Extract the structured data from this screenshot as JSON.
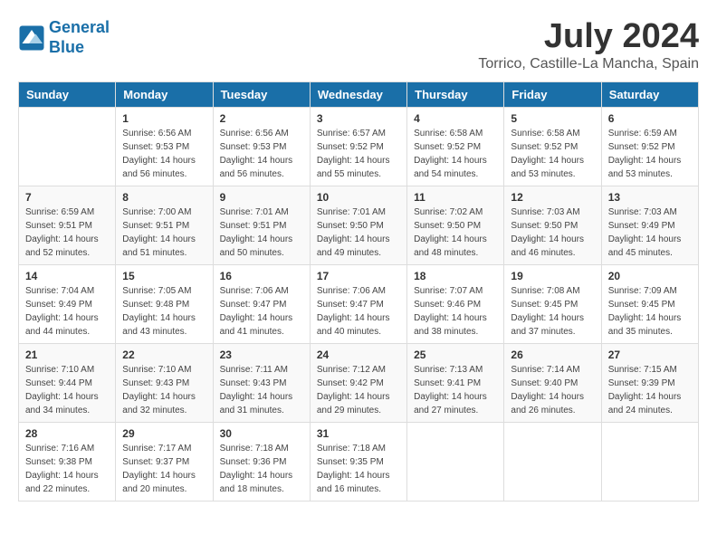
{
  "app": {
    "name_line1": "General",
    "name_line2": "Blue"
  },
  "header": {
    "title": "July 2024",
    "subtitle": "Torrico, Castille-La Mancha, Spain"
  },
  "columns": [
    "Sunday",
    "Monday",
    "Tuesday",
    "Wednesday",
    "Thursday",
    "Friday",
    "Saturday"
  ],
  "weeks": [
    [
      {
        "day": "",
        "sunrise": "",
        "sunset": "",
        "daylight": ""
      },
      {
        "day": "1",
        "sunrise": "Sunrise: 6:56 AM",
        "sunset": "Sunset: 9:53 PM",
        "daylight": "Daylight: 14 hours and 56 minutes."
      },
      {
        "day": "2",
        "sunrise": "Sunrise: 6:56 AM",
        "sunset": "Sunset: 9:53 PM",
        "daylight": "Daylight: 14 hours and 56 minutes."
      },
      {
        "day": "3",
        "sunrise": "Sunrise: 6:57 AM",
        "sunset": "Sunset: 9:52 PM",
        "daylight": "Daylight: 14 hours and 55 minutes."
      },
      {
        "day": "4",
        "sunrise": "Sunrise: 6:58 AM",
        "sunset": "Sunset: 9:52 PM",
        "daylight": "Daylight: 14 hours and 54 minutes."
      },
      {
        "day": "5",
        "sunrise": "Sunrise: 6:58 AM",
        "sunset": "Sunset: 9:52 PM",
        "daylight": "Daylight: 14 hours and 53 minutes."
      },
      {
        "day": "6",
        "sunrise": "Sunrise: 6:59 AM",
        "sunset": "Sunset: 9:52 PM",
        "daylight": "Daylight: 14 hours and 53 minutes."
      }
    ],
    [
      {
        "day": "7",
        "sunrise": "Sunrise: 6:59 AM",
        "sunset": "Sunset: 9:51 PM",
        "daylight": "Daylight: 14 hours and 52 minutes."
      },
      {
        "day": "8",
        "sunrise": "Sunrise: 7:00 AM",
        "sunset": "Sunset: 9:51 PM",
        "daylight": "Daylight: 14 hours and 51 minutes."
      },
      {
        "day": "9",
        "sunrise": "Sunrise: 7:01 AM",
        "sunset": "Sunset: 9:51 PM",
        "daylight": "Daylight: 14 hours and 50 minutes."
      },
      {
        "day": "10",
        "sunrise": "Sunrise: 7:01 AM",
        "sunset": "Sunset: 9:50 PM",
        "daylight": "Daylight: 14 hours and 49 minutes."
      },
      {
        "day": "11",
        "sunrise": "Sunrise: 7:02 AM",
        "sunset": "Sunset: 9:50 PM",
        "daylight": "Daylight: 14 hours and 48 minutes."
      },
      {
        "day": "12",
        "sunrise": "Sunrise: 7:03 AM",
        "sunset": "Sunset: 9:50 PM",
        "daylight": "Daylight: 14 hours and 46 minutes."
      },
      {
        "day": "13",
        "sunrise": "Sunrise: 7:03 AM",
        "sunset": "Sunset: 9:49 PM",
        "daylight": "Daylight: 14 hours and 45 minutes."
      }
    ],
    [
      {
        "day": "14",
        "sunrise": "Sunrise: 7:04 AM",
        "sunset": "Sunset: 9:49 PM",
        "daylight": "Daylight: 14 hours and 44 minutes."
      },
      {
        "day": "15",
        "sunrise": "Sunrise: 7:05 AM",
        "sunset": "Sunset: 9:48 PM",
        "daylight": "Daylight: 14 hours and 43 minutes."
      },
      {
        "day": "16",
        "sunrise": "Sunrise: 7:06 AM",
        "sunset": "Sunset: 9:47 PM",
        "daylight": "Daylight: 14 hours and 41 minutes."
      },
      {
        "day": "17",
        "sunrise": "Sunrise: 7:06 AM",
        "sunset": "Sunset: 9:47 PM",
        "daylight": "Daylight: 14 hours and 40 minutes."
      },
      {
        "day": "18",
        "sunrise": "Sunrise: 7:07 AM",
        "sunset": "Sunset: 9:46 PM",
        "daylight": "Daylight: 14 hours and 38 minutes."
      },
      {
        "day": "19",
        "sunrise": "Sunrise: 7:08 AM",
        "sunset": "Sunset: 9:45 PM",
        "daylight": "Daylight: 14 hours and 37 minutes."
      },
      {
        "day": "20",
        "sunrise": "Sunrise: 7:09 AM",
        "sunset": "Sunset: 9:45 PM",
        "daylight": "Daylight: 14 hours and 35 minutes."
      }
    ],
    [
      {
        "day": "21",
        "sunrise": "Sunrise: 7:10 AM",
        "sunset": "Sunset: 9:44 PM",
        "daylight": "Daylight: 14 hours and 34 minutes."
      },
      {
        "day": "22",
        "sunrise": "Sunrise: 7:10 AM",
        "sunset": "Sunset: 9:43 PM",
        "daylight": "Daylight: 14 hours and 32 minutes."
      },
      {
        "day": "23",
        "sunrise": "Sunrise: 7:11 AM",
        "sunset": "Sunset: 9:43 PM",
        "daylight": "Daylight: 14 hours and 31 minutes."
      },
      {
        "day": "24",
        "sunrise": "Sunrise: 7:12 AM",
        "sunset": "Sunset: 9:42 PM",
        "daylight": "Daylight: 14 hours and 29 minutes."
      },
      {
        "day": "25",
        "sunrise": "Sunrise: 7:13 AM",
        "sunset": "Sunset: 9:41 PM",
        "daylight": "Daylight: 14 hours and 27 minutes."
      },
      {
        "day": "26",
        "sunrise": "Sunrise: 7:14 AM",
        "sunset": "Sunset: 9:40 PM",
        "daylight": "Daylight: 14 hours and 26 minutes."
      },
      {
        "day": "27",
        "sunrise": "Sunrise: 7:15 AM",
        "sunset": "Sunset: 9:39 PM",
        "daylight": "Daylight: 14 hours and 24 minutes."
      }
    ],
    [
      {
        "day": "28",
        "sunrise": "Sunrise: 7:16 AM",
        "sunset": "Sunset: 9:38 PM",
        "daylight": "Daylight: 14 hours and 22 minutes."
      },
      {
        "day": "29",
        "sunrise": "Sunrise: 7:17 AM",
        "sunset": "Sunset: 9:37 PM",
        "daylight": "Daylight: 14 hours and 20 minutes."
      },
      {
        "day": "30",
        "sunrise": "Sunrise: 7:18 AM",
        "sunset": "Sunset: 9:36 PM",
        "daylight": "Daylight: 14 hours and 18 minutes."
      },
      {
        "day": "31",
        "sunrise": "Sunrise: 7:18 AM",
        "sunset": "Sunset: 9:35 PM",
        "daylight": "Daylight: 14 hours and 16 minutes."
      },
      {
        "day": "",
        "sunrise": "",
        "sunset": "",
        "daylight": ""
      },
      {
        "day": "",
        "sunrise": "",
        "sunset": "",
        "daylight": ""
      },
      {
        "day": "",
        "sunrise": "",
        "sunset": "",
        "daylight": ""
      }
    ]
  ]
}
